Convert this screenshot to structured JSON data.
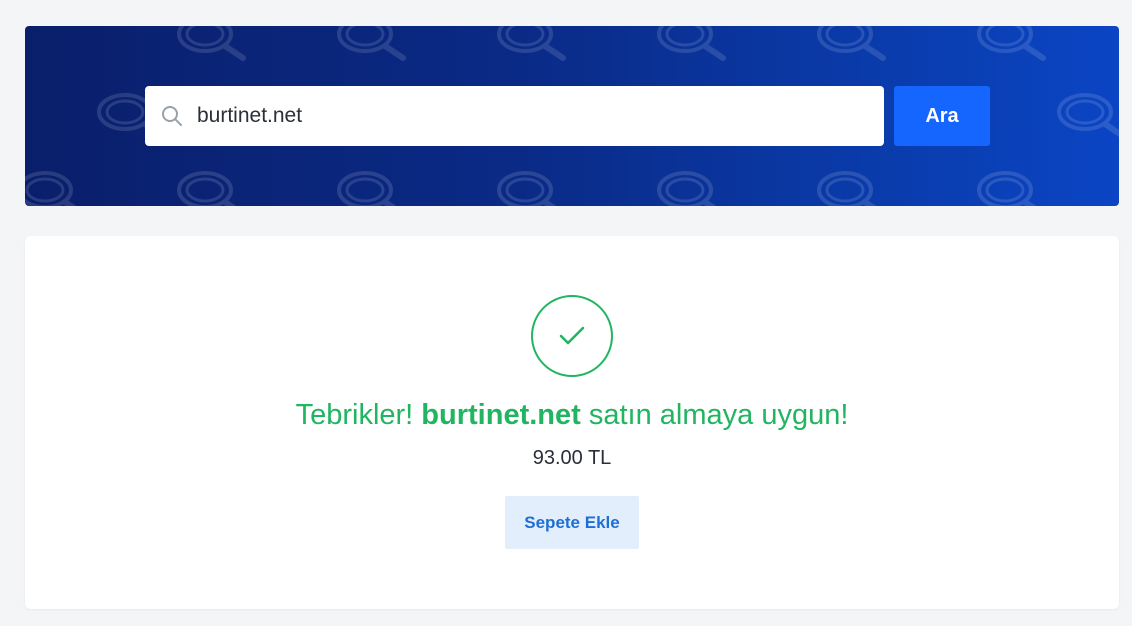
{
  "search": {
    "value": "burtinet.net",
    "button_label": "Ara"
  },
  "result": {
    "prefix": "Tebrikler! ",
    "domain": "burtinet.net",
    "suffix": " satın almaya uygun!",
    "price": "93.00 TL",
    "add_to_cart_label": "Sepete Ekle",
    "status_color": "#22b561"
  },
  "icons": {
    "search": "search-icon",
    "success": "check-icon",
    "pattern": "magnifier-pattern"
  },
  "colors": {
    "hero_start": "#0a1f6b",
    "hero_end": "#0b45c4",
    "primary_button": "#1565ff",
    "secondary_button_bg": "#e3eefc",
    "secondary_button_text": "#1d6fd6"
  }
}
